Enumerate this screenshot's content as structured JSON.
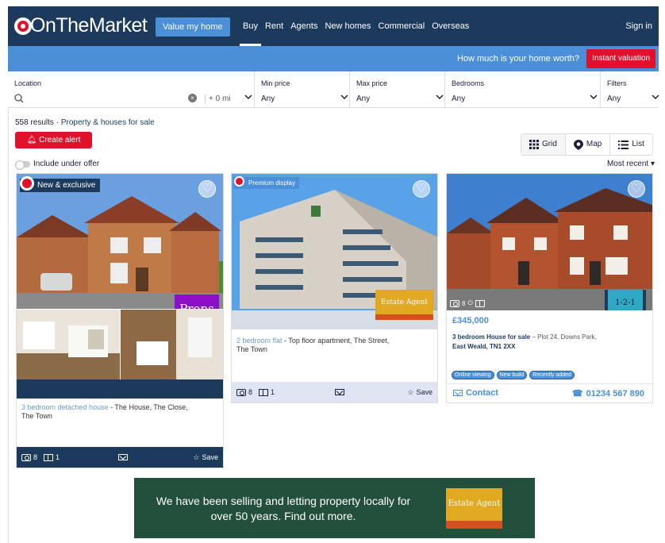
{
  "header": {
    "logo": "OnTheMarket",
    "value_button": "Value my home",
    "nav": [
      "Buy",
      "Rent",
      "Agents",
      "New homes",
      "Commercial",
      "Overseas"
    ],
    "active_nav": "Buy",
    "signin": "Sign in"
  },
  "valuation_bar": {
    "text": "How much is your home worth?",
    "button": "Instant valuation"
  },
  "filters": {
    "location": {
      "label": "Location",
      "radius": "+ 0 mi"
    },
    "min_price": {
      "label": "Min price",
      "value": "Any"
    },
    "max_price": {
      "label": "Max price",
      "value": "Any"
    },
    "bedrooms": {
      "label": "Bedrooms",
      "value": "Any"
    },
    "more": {
      "label": "Filters",
      "value": "Any"
    }
  },
  "results": {
    "count": "558 results",
    "sep": "·",
    "title": "Property & houses for sale"
  },
  "create_alert": "Create alert",
  "views": {
    "grid": "Grid",
    "map": "Map",
    "list": "List"
  },
  "under_offer": "Include under offer",
  "sort": "Most recent",
  "cards": [
    {
      "badge": "New & exclusive",
      "tag": "Props",
      "link": "3 bedroom detached house",
      "desc1": " - The House, The Close,",
      "desc2": "The Town",
      "photos": "8",
      "plans": "1",
      "save": "Save"
    },
    {
      "badge": "Premium display",
      "tag": "Estate Agent",
      "link": "2 bedroom flat",
      "desc1": " - Top floor apartment, The Street,",
      "desc2": "The Town",
      "photos": "8",
      "plans": "1",
      "save": "Save"
    },
    {
      "tag": "1-2-1",
      "photos": "8",
      "price": "£345,000",
      "title": "3 bedroom House for sale",
      "desc1": " – Plot 24, Downs Park,",
      "desc2": "East Weald, TN1 2XX",
      "pills": [
        "Online viewing",
        "New build",
        "Recently added"
      ],
      "contact": "Contact",
      "phone": "01234 567 890"
    }
  ],
  "promo": {
    "text": "We have been selling and letting property locally for over 50 years. Find out more.",
    "agent": "Estate Agent"
  },
  "colors": {
    "navy": "#1b3a5c",
    "blue": "#4a8fd8",
    "red": "#e2112b",
    "promo_green": "#22503c"
  }
}
